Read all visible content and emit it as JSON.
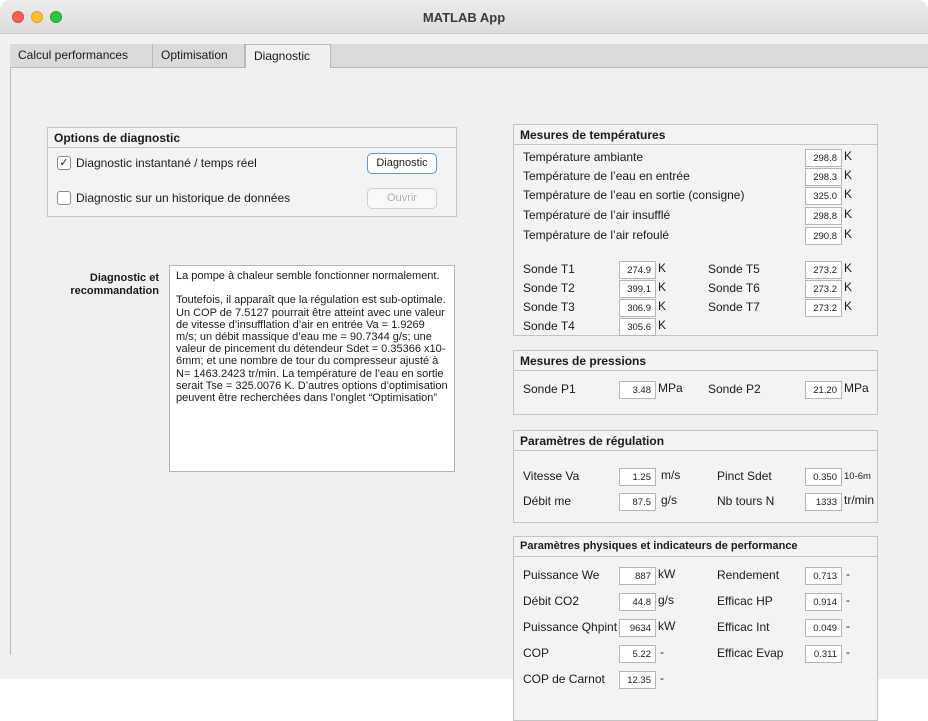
{
  "window": {
    "title": "MATLAB App"
  },
  "tabs": [
    {
      "label": "Calcul performances"
    },
    {
      "label": "Optimisation"
    },
    {
      "label": "Diagnostic"
    }
  ],
  "options": {
    "title": "Options de diagnostic",
    "realtime_label": "Diagnostic instantané / temps réel",
    "realtime_checked": "✓",
    "history_label": "Diagnostic sur un historique de données",
    "diagnostic_button": "Diagnostic",
    "open_button": "Ouvrir"
  },
  "recommendation": {
    "label_line1": "Diagnostic et",
    "label_line2": "recommandation",
    "text": "La pompe à chaleur semble fonctionner normalement.\n\nToutefois, il apparaît que la régulation est sub-optimale. Un COP de 7.5127 pourrait être atteint avec une valeur de vitesse d’insufflation d’air en entrée Va = 1.9269 m/s; un débit massique d’eau me = 90.7344 g/s; une valeur de pincement du détendeur Sdet = 0.35366 x10-6mm; et une nombre de tour du compresseur ajusté à N= 1463.2423 tr/min. La température de l’eau en sortie serait Tse = 325.0076 K. D’autres options d’optimisation peuvent être recherchées dans l’onglet “Optimisation”"
  },
  "temperatures": {
    "title": "Mesures de températures",
    "rows": [
      {
        "label": "Température ambiante",
        "value": "298.8",
        "unit": "K"
      },
      {
        "label": "Température de l’eau en entrée",
        "value": "298.3",
        "unit": "K"
      },
      {
        "label": "Température de l’eau en sortie (consigne)",
        "value": "325.0",
        "unit": "K"
      },
      {
        "label": "Température de l’air insufflé",
        "value": "298.8",
        "unit": "K"
      },
      {
        "label": "Température de l’air refoulé",
        "value": "290.8",
        "unit": "K"
      }
    ],
    "probes_left": [
      {
        "label": "Sonde T1",
        "value": "274.9",
        "unit": "K"
      },
      {
        "label": "Sonde T2",
        "value": "399.1",
        "unit": "K"
      },
      {
        "label": "Sonde T3",
        "value": "306.9",
        "unit": "K"
      },
      {
        "label": "Sonde T4",
        "value": "305.6",
        "unit": "K"
      }
    ],
    "probes_right": [
      {
        "label": "Sonde T5",
        "value": "273.2",
        "unit": "K"
      },
      {
        "label": "Sonde T6",
        "value": "273.2",
        "unit": "K"
      },
      {
        "label": "Sonde T7",
        "value": "273.2",
        "unit": "K"
      }
    ]
  },
  "pressures": {
    "title": "Mesures de pressions",
    "p1": {
      "label": "Sonde P1",
      "value": "3.48",
      "unit": "MPa"
    },
    "p2": {
      "label": "Sonde P2",
      "value": "21.20",
      "unit": "MPa"
    }
  },
  "regulation": {
    "title": "Paramètres de régulation",
    "va": {
      "label": "Vitesse Va",
      "value": "1.25",
      "unit": "m/s"
    },
    "me": {
      "label": "Débit me",
      "value": "87.5",
      "unit": "g/s"
    },
    "sdet": {
      "label": "Pinct Sdet",
      "value": "0.350",
      "unit": "10-6m"
    },
    "n": {
      "label": "Nb tours N",
      "value": "1333",
      "unit": "tr/min"
    }
  },
  "physical": {
    "title": "Paramètres physiques et indicateurs de performance",
    "left": [
      {
        "label": "Puissance We",
        "value": "887",
        "unit": "kW"
      },
      {
        "label": "Débit CO2",
        "value": "44.8",
        "unit": "g/s"
      },
      {
        "label": "Puissance Qhpint",
        "value": "9634",
        "unit": "kW"
      },
      {
        "label": "COP",
        "value": "5.22",
        "unit": "-"
      },
      {
        "label": "COP de Carnot",
        "value": "12.35",
        "unit": "-"
      }
    ],
    "right": [
      {
        "label": "Rendement",
        "value": "0.713",
        "unit": "-"
      },
      {
        "label": "Efficac HP",
        "value": "0.914",
        "unit": "-"
      },
      {
        "label": "Efficac Int",
        "value": "0.049",
        "unit": "-"
      },
      {
        "label": "Efficac Evap",
        "value": "0.311",
        "unit": "-"
      }
    ]
  }
}
